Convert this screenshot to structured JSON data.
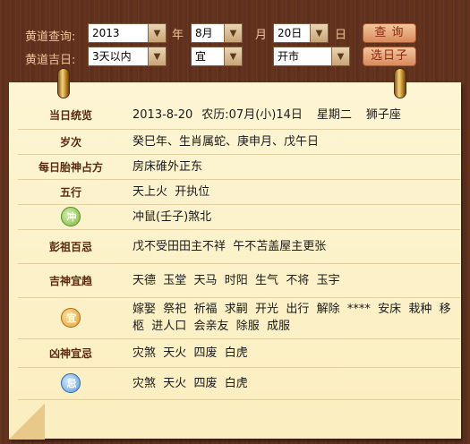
{
  "topbar": {
    "query_label": "黄道查询:",
    "year": "2013",
    "year_unit": "年",
    "month": "8月",
    "month_unit": "月",
    "day": "20日",
    "day_unit": "日",
    "query_button": "查 询",
    "lucky_label": "黄道吉日:",
    "range": "3天以内",
    "yi_ji": "宜",
    "activity": "开市",
    "pick_button": "选日子"
  },
  "rows": [
    {
      "key": "当日统览",
      "date": "2013-8-20",
      "lunar": "农历:07月(小)14日",
      "weekday": "星期二",
      "zodiac": "狮子座"
    },
    {
      "key": "岁次",
      "value": "癸巳年、生肖属蛇、庚申月、戊午日"
    },
    {
      "key": "每日胎神占方",
      "value": "房床碓外正东"
    },
    {
      "key": "五行",
      "value": "天上火  开执位"
    },
    {
      "icon": "chong-icon",
      "icon_text": "冲",
      "value": "冲鼠(壬子)煞北"
    },
    {
      "key": "彭祖百忌",
      "value": "戊不受田田主不祥  午不苫盖屋主更张"
    },
    {
      "key": "吉神宜趋",
      "value": "天德  玉堂  天马  时阳  生气  不将  玉宇"
    },
    {
      "icon": "yi-icon",
      "icon_text": "宜",
      "value": "嫁娶  祭祀  祈福  求嗣  开光  出行  解除  ****  安床  栽种  移柩  进人口  会亲友  除服  成服"
    },
    {
      "key": "凶神宜忌",
      "value": "灾煞  天火  四废  白虎"
    },
    {
      "icon": "ji-icon",
      "icon_text": "忌",
      "value": "灾煞  天火  四废  白虎"
    }
  ]
}
